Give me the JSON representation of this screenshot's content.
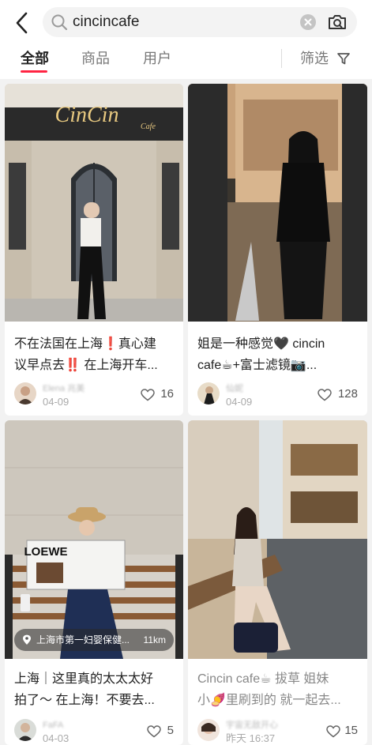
{
  "search": {
    "query": "cincincafe"
  },
  "tabs": [
    {
      "label": "全部"
    },
    {
      "label": "商品"
    },
    {
      "label": "用户"
    }
  ],
  "filter": {
    "label": "筛选"
  },
  "colors": {
    "accent": "#ff2442",
    "background": "#f2f2f2"
  },
  "icons": [
    "back-arrow-icon",
    "search-icon",
    "clear-icon",
    "camera-icon",
    "filter-icon",
    "heart-icon",
    "location-pin-icon"
  ],
  "cards": [
    {
      "title_line1": "不在法国在上海❗真心建",
      "title_line2": "议早点去‼️ 在上海开车...",
      "photo_sign": "CinCin",
      "photo_sign_small": "Cafe",
      "author": "Elena 兆美",
      "date": "04-09",
      "likes": "16"
    },
    {
      "title_line1": "姐是一种感觉🖤 cincin",
      "title_line2": "cafe☕+富士滤镜📷...",
      "author": "仙妮",
      "date": "04-09",
      "likes": "128"
    },
    {
      "title_line1": "上海｜这里真的太太太好",
      "title_line2": "拍了～ 在上海！不要去...",
      "location": "上海市第一妇婴保健...",
      "distance": "11km",
      "newspaper": "LOEWE",
      "author": "FaFA",
      "date": "04-03",
      "likes": "5"
    },
    {
      "title_line1": "Cincin cafe☕ 拔草 姐妹",
      "title_line2": "小🍠里刷到的 就一起去...",
      "author": "宇宙无敌开心",
      "date": "昨天 16:37",
      "likes": "15"
    }
  ]
}
